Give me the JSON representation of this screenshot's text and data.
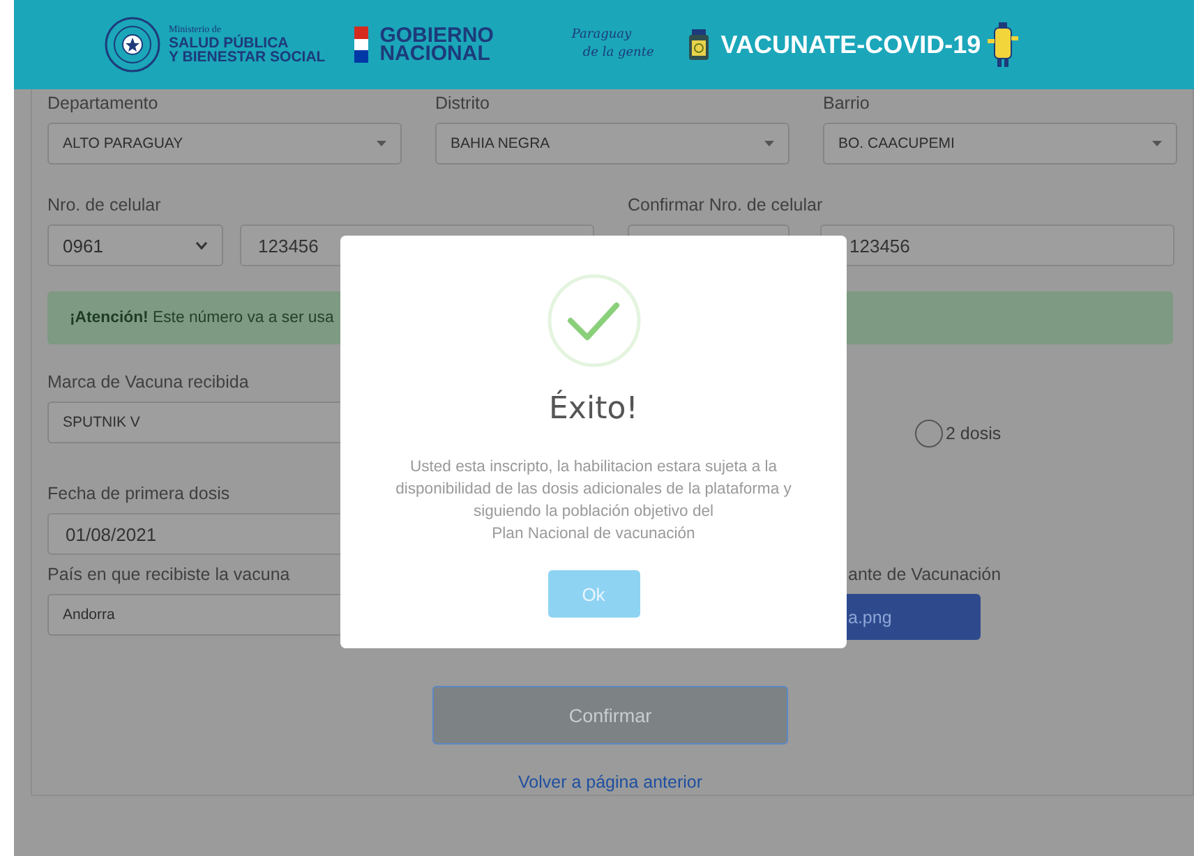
{
  "header": {
    "ministry_small": "Ministerio de",
    "ministry_lines": [
      "SALUD PÚBLICA",
      "Y BIENESTAR SOCIAL"
    ],
    "government_lines": [
      "GOBIERNO",
      "NACIONAL"
    ],
    "slogan_lines": [
      "Paraguay",
      "de la gente"
    ],
    "campaign": "VACUNATE-COVID-19"
  },
  "location": [
    {
      "label": "Departamento",
      "value": "ALTO PARAGUAY"
    },
    {
      "label": "Distrito",
      "value": "BAHIA NEGRA"
    },
    {
      "label": "Barrio",
      "value": "BO. CAACUPEMI"
    }
  ],
  "phones": [
    {
      "label": "Nro. de celular",
      "prefix": "0961",
      "number": "123456"
    },
    {
      "label": "Confirmar Nro. de celular",
      "number": "123456"
    }
  ],
  "alert": "**¡Atención!** Este número va a ser usa",
  "vaccine_brand": {
    "label": "Marca de Vacuna recibida",
    "value": "SPUTNIK V"
  },
  "doses": [
    {
      "label": "2 dosis",
      "selected": false
    }
  ],
  "first_dose_date": {
    "label": "Fecha de primera dosis",
    "value": "01/08/2021"
  },
  "country": {
    "label": "País en que recibiste la vacuna",
    "value": "Andorra"
  },
  "certificate": {
    "label": "ante de Vacunación",
    "file": "a.png"
  },
  "confirm_button": {
    "label": "Confirmar",
    "disabled": true
  },
  "back_link": "Volver a página anterior",
  "dialog": {
    "title": "Éxito!",
    "message": "Usted esta inscripto, la habilitacion estara sujeta a la\ndisponibilidad de las dosis adicionales de la plataforma y\nsiguiendo la población objetivo del\nPlan Nacional de vacunación",
    "button": "Ok"
  }
}
